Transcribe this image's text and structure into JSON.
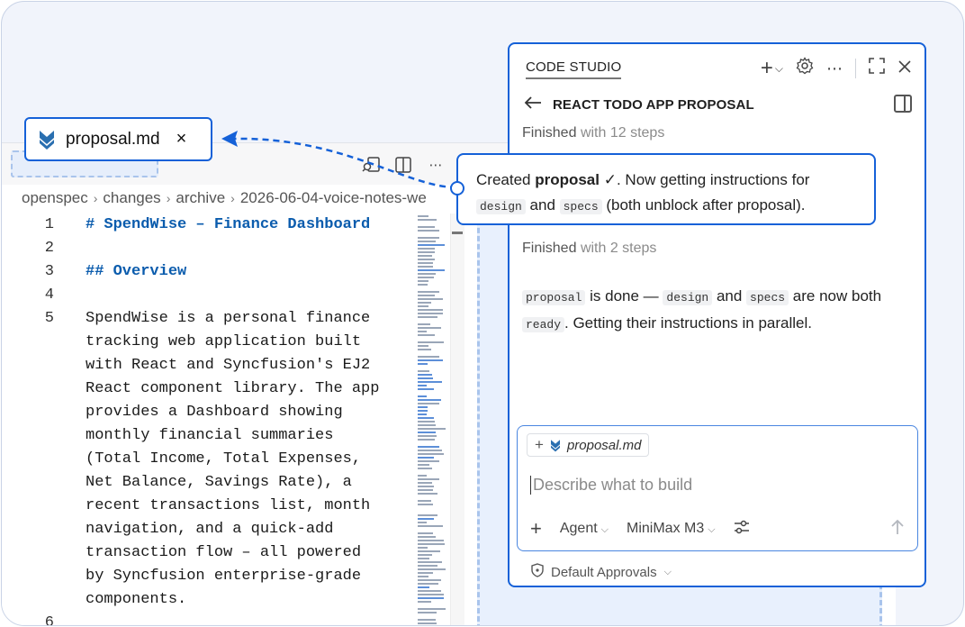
{
  "floating_tab": {
    "filename": "proposal.md",
    "close_label": "×"
  },
  "breadcrumb": [
    "openspec",
    "changes",
    "archive",
    "2026-06-04-voice-notes-we"
  ],
  "code": {
    "lines": [
      {
        "num": "1",
        "text": "# SpendWise – Finance Dashboard",
        "heading": true
      },
      {
        "num": "2",
        "text": "",
        "heading": false
      },
      {
        "num": "3",
        "text": "## Overview",
        "heading": true
      },
      {
        "num": "4",
        "text": "",
        "heading": false
      },
      {
        "num": "5",
        "text": "SpendWise is a personal finance\ntracking web application built\nwith React and Syncfusion's EJ2\nReact component library. The app\nprovides a Dashboard showing\nmonthly financial summaries\n(Total Income, Total Expenses,\nNet Balance, Savings Rate), a\nrecent transactions list, month\nnavigation, and a quick-add\ntransaction flow – all powered\nby Syncfusion enterprise-grade\ncomponents.",
        "heading": false
      },
      {
        "num": "6",
        "text": "",
        "heading": false
      }
    ]
  },
  "panel": {
    "title": "CODE STUDIO",
    "subtitle": "REACT TODO APP PROPOSAL",
    "finished_1": {
      "label": "Finished",
      "detail": "with 12 steps"
    },
    "finished_2": {
      "label": "Finished",
      "detail": "with 2 steps"
    },
    "message_2": {
      "t1": "proposal",
      "t2": " is done — ",
      "t3": "design",
      "t4": " and ",
      "t5": "specs",
      "t6": " are now both ",
      "t7": "ready",
      "t8": ". Getting their instructions in parallel."
    },
    "composer": {
      "chip_file": "proposal.md",
      "placeholder": "Describe what to build",
      "mode": "Agent",
      "model": "MiniMax M3"
    },
    "approvals": "Default Approvals"
  },
  "callout": {
    "p1": "Created ",
    "p2": "proposal",
    "p3": " ✓. Now getting instructions for",
    "p4": "design",
    "p5": " and ",
    "p6": "specs",
    "p7": " (both unblock after proposal)."
  },
  "colors": {
    "accent": "#1561d8",
    "heading": "#0b5cad",
    "dropzone": "#e8f0fd",
    "download_icon": "#2a6fb0"
  }
}
